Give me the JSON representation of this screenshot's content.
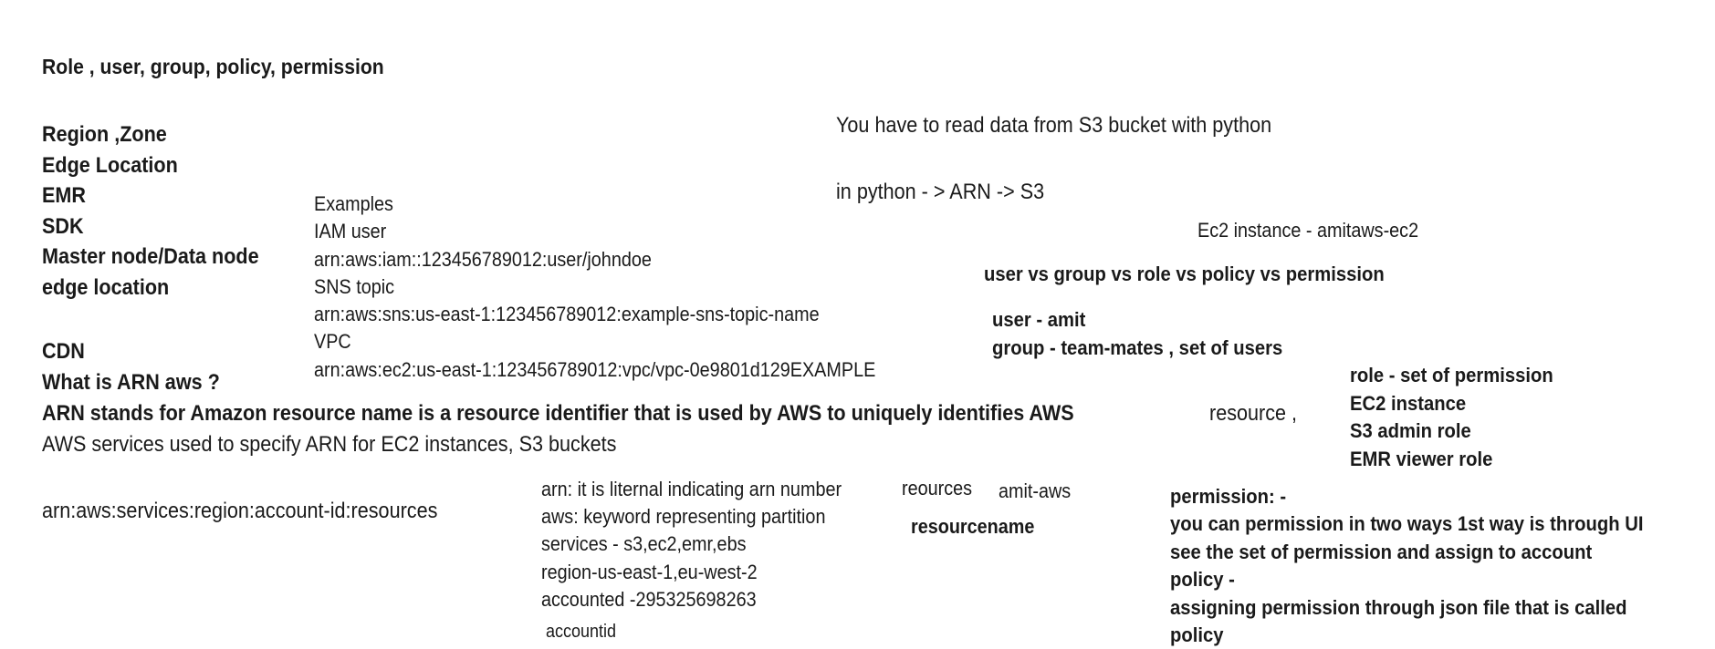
{
  "title": "Role , user, group, policy, permission",
  "topics": [
    "Region ,Zone",
    "Edge Location",
    "EMR",
    "SDK",
    "Master node/Data node",
    "edge location"
  ],
  "cdn": "CDN",
  "arn_question": "What is ARN aws ?",
  "arn_definition_bold": "ARN stands for Amazon resource name is a resource identifier that is used by AWS to uniquely identifies AWS",
  "arn_definition_tail": "resource ,",
  "arn_definition_line2": "AWS services used to specify ARN for EC2 instances, S3 buckets",
  "examples": {
    "lines": [
      "Examples",
      "IAM user",
      "arn:aws:iam::123456789012:user/johndoe",
      "SNS topic",
      "arn:aws:sns:us-east-1:123456789012:example-sns-topic-name",
      "VPC",
      "arn:aws:ec2:us-east-1:123456789012:vpc/vpc-0e9801d129EXAMPLE"
    ]
  },
  "arn_format": "arn:aws:services:region:account-id:resources",
  "arn_parts": [
    "arn: it is liternal indicating arn number",
    "aws: keyword representing partition",
    "services - s3,ec2,emr,ebs",
    "region-us-east-1,eu-west-2",
    "accounted -295325698263"
  ],
  "accountid": "accountid",
  "reources_label": "reources",
  "amit_aws": "amit-aws",
  "resourcename": "resourcename",
  "s3_note": "You have to read data from S3 bucket with python",
  "python_arn": "in python - > ARN -> S3",
  "ec2_instance": "Ec2 instance - amitaws-ec2",
  "comparison_heading": "user vs group vs role vs policy vs permission",
  "user_line": "user - amit",
  "group_line": "group - team-mates , set of users",
  "role_block": [
    "role - set of permission",
    "EC2 instance",
    "S3 admin role",
    "EMR viewer role"
  ],
  "permission_block": [
    "permission: -",
    "you can permission in two ways 1st way is through UI",
    "see the set of permission and assign to account",
    "policy -",
    "assigning permission through json file that is called",
    "policy"
  ]
}
